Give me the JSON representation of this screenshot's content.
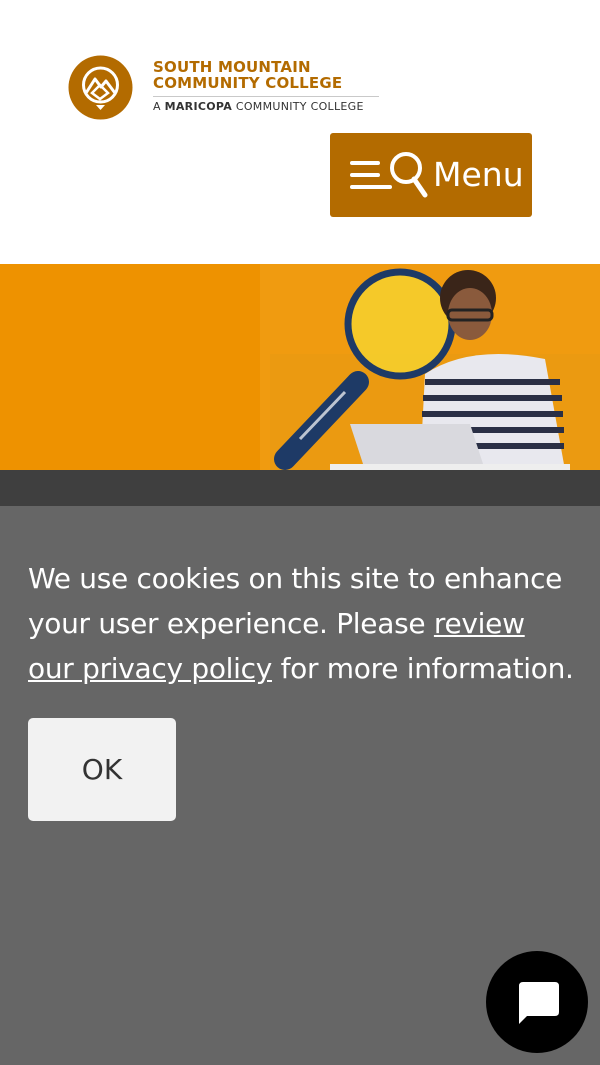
{
  "header": {
    "logo": {
      "line1": "SOUTH MOUNTAIN",
      "line2": "COMMUNITY COLLEGE",
      "line3_prefix": "A ",
      "line3_bold": "MARICOPA",
      "line3_suffix": " COMMUNITY COLLEGE"
    },
    "menu_label": "Menu"
  },
  "cookie_banner": {
    "text_before_link": "We use cookies on this site to enhance your user experience. Please ",
    "link_text": "review our privacy policy",
    "text_after_link": " for more information.",
    "ok_label": "OK"
  },
  "colors": {
    "brand": "#b36b00",
    "hero": "#ee9200",
    "overlay": "#666666",
    "chat": "#000000"
  },
  "icons": [
    "college-logo-icon",
    "hamburger-icon",
    "search-icon",
    "chat-icon"
  ]
}
